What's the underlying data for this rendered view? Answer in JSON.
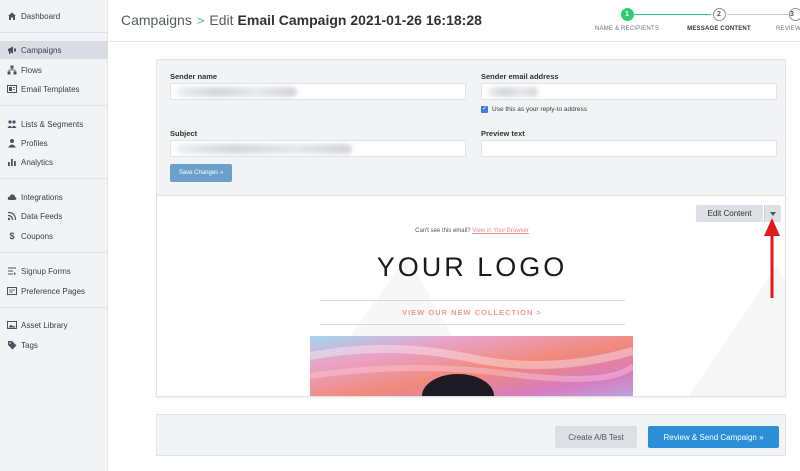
{
  "sidebar": {
    "items": [
      {
        "label": "Dashboard",
        "icon": "home-icon"
      },
      {
        "label": "Campaigns",
        "icon": "megaphone-icon",
        "active": true
      },
      {
        "label": "Flows",
        "icon": "flows-icon"
      },
      {
        "label": "Email Templates",
        "icon": "template-icon"
      },
      {
        "label": "Lists & Segments",
        "icon": "users-icon"
      },
      {
        "label": "Profiles",
        "icon": "person-icon"
      },
      {
        "label": "Analytics",
        "icon": "chart-icon"
      },
      {
        "label": "Integrations",
        "icon": "cloud-icon"
      },
      {
        "label": "Data Feeds",
        "icon": "rss-icon"
      },
      {
        "label": "Coupons",
        "icon": "dollar-icon"
      },
      {
        "label": "Signup Forms",
        "icon": "form-icon"
      },
      {
        "label": "Preference Pages",
        "icon": "card-icon"
      },
      {
        "label": "Asset Library",
        "icon": "image-icon"
      },
      {
        "label": "Tags",
        "icon": "tag-icon"
      }
    ]
  },
  "header": {
    "breadcrumb_root": "Campaigns",
    "breadcrumb_sep": ">",
    "edit_prefix": "Edit",
    "campaign_title": "Email Campaign 2021-01-26 16:18:28",
    "steps": [
      {
        "number": "1",
        "label": "NAME & RECIPIENTS",
        "status": "done"
      },
      {
        "number": "2",
        "label": "MESSAGE CONTENT",
        "status": "current"
      },
      {
        "number": "3",
        "label": "REVIEW &",
        "status": "todo"
      }
    ]
  },
  "form": {
    "sender_name_label": "Sender name",
    "sender_email_label": "Sender email address",
    "reply_to_label": "Use this as your reply-to address",
    "reply_to_checked": true,
    "subject_label": "Subject",
    "preview_text_label": "Preview text",
    "save_button": "Save Changes »"
  },
  "preview": {
    "edit_content_button": "Edit Content",
    "cant_see_text": "Can't see this email?",
    "view_in_browser_link": "View in Your Browser",
    "logo_text": "YOUR LOGO",
    "collection_link": "VIEW OUR NEW COLLECTION >"
  },
  "footer": {
    "ab_test_button": "Create A/B Test",
    "review_send_button": "Review & Send Campaign »"
  },
  "colors": {
    "accent_green": "#2ecc71",
    "primary_blue": "#2a8fd6",
    "annotation_red": "#e01b1b",
    "link_pink": "#ec9a94"
  }
}
